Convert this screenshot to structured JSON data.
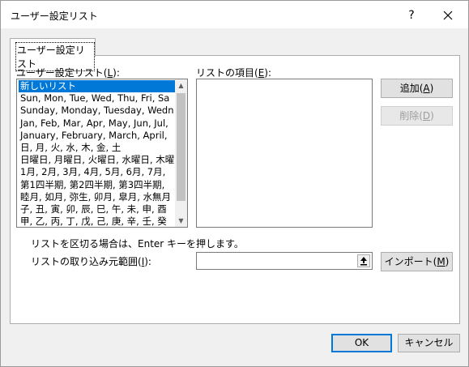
{
  "window": {
    "title": "ユーザー設定リスト",
    "help": "?",
    "close_icon": "close-icon"
  },
  "tab": {
    "label": "ユーザー設定リスト"
  },
  "lists_section": {
    "label_pre": "ユーザー設定リスト(",
    "label_key": "L",
    "label_post": "):",
    "items": [
      "新しいリスト",
      "Sun, Mon, Tue, Wed, Thu, Fri, Sa",
      "Sunday, Monday, Tuesday, Wedn",
      "Jan, Feb, Mar, Apr, May, Jun, Jul,",
      "January, February, March, April,",
      "日, 月, 火, 水, 木, 金, 土",
      "日曜日, 月曜日, 火曜日, 水曜日, 木曜",
      "1月, 2月, 3月, 4月, 5月, 6月, 7月,",
      "第1四半期, 第2四半期, 第3四半期,",
      "睦月, 如月, 弥生, 卯月, 皐月, 水無月",
      "子, 丑, 寅, 卯, 辰, 巳, 午, 未, 申, 酉",
      "甲, 乙, 丙, 丁, 戊, 己, 庚, 辛, 壬, 癸"
    ],
    "selected_index": 0,
    "scroll_up_icon": "scroll-up-icon",
    "scroll_down_icon": "scroll-down-icon"
  },
  "entries_section": {
    "label_pre": "リストの項目(",
    "label_key": "E",
    "label_post": "):",
    "value": ""
  },
  "buttons": {
    "add": {
      "pre": "追加(",
      "key": "A",
      "post": ")"
    },
    "delete": {
      "pre": "削除(",
      "key": "D",
      "post": ")"
    },
    "import": {
      "pre": "インポート(",
      "key": "M",
      "post": ")"
    },
    "ok": "OK",
    "cancel": "キャンセル"
  },
  "hint": "リストを区切る場合は、Enter キーを押します。",
  "import_section": {
    "label_pre": "リストの取り込み元範囲(",
    "label_key": "I",
    "label_post": "):",
    "value": "",
    "collapse_icon": "range-collapse-icon"
  },
  "colors": {
    "selection": "#0078d7",
    "dialog_background": "#f0f0f0"
  }
}
